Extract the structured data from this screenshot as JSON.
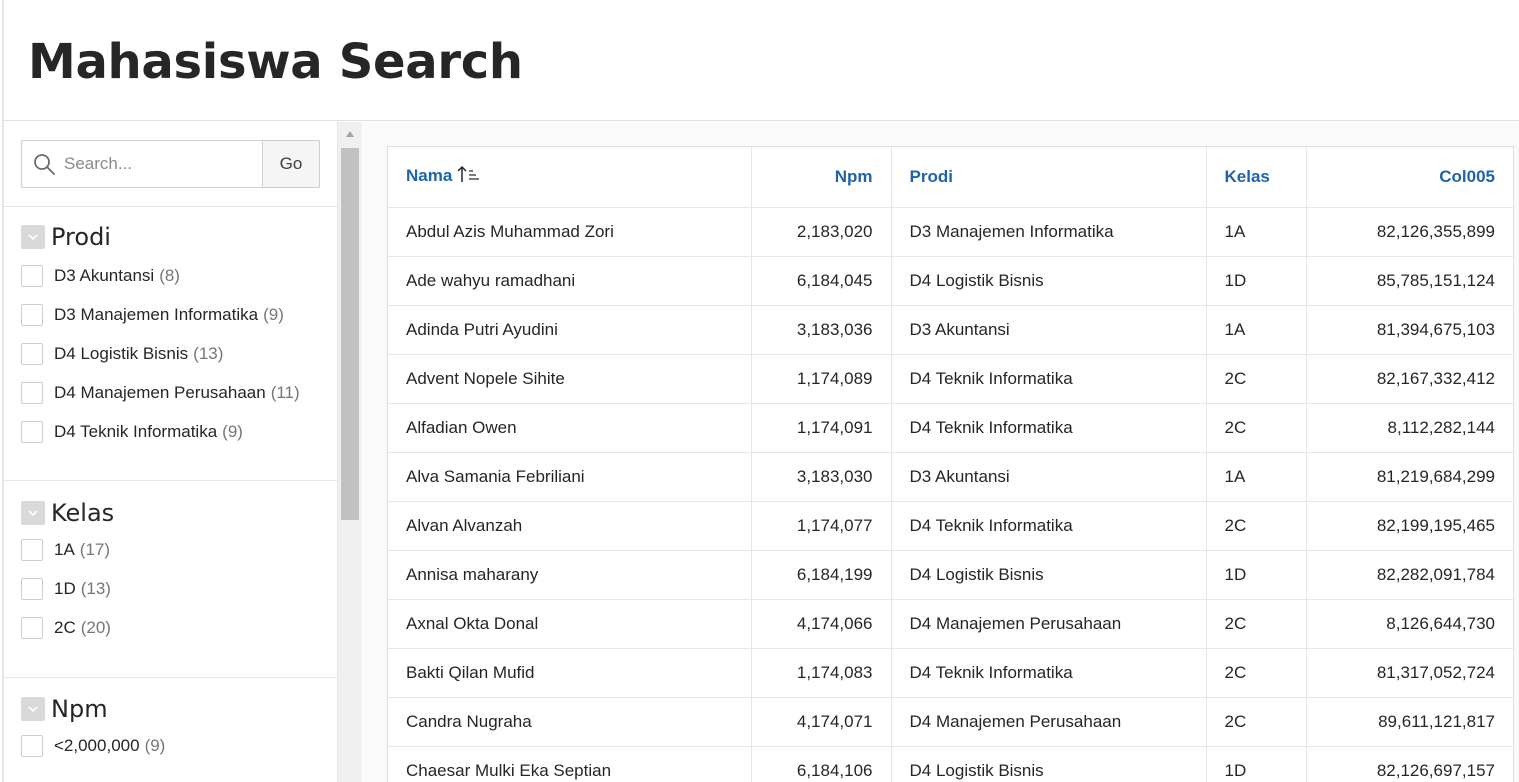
{
  "page": {
    "title": "Mahasiswa Search"
  },
  "search": {
    "placeholder": "Search...",
    "value": "",
    "go_label": "Go"
  },
  "facets": [
    {
      "title": "Prodi",
      "options": [
        {
          "label": "D3 Akuntansi",
          "count": "(8)"
        },
        {
          "label": "D3 Manajemen Informatika",
          "count": "(9)"
        },
        {
          "label": "D4 Logistik Bisnis",
          "count": "(13)"
        },
        {
          "label": "D4 Manajemen Perusahaan",
          "count": "(11)"
        },
        {
          "label": "D4 Teknik Informatika",
          "count": "(9)"
        }
      ]
    },
    {
      "title": "Kelas",
      "options": [
        {
          "label": "1A",
          "count": "(17)"
        },
        {
          "label": "1D",
          "count": "(13)"
        },
        {
          "label": "2C",
          "count": "(20)"
        }
      ]
    },
    {
      "title": "Npm",
      "options": [
        {
          "label": "<2,000,000",
          "count": "(9)"
        }
      ]
    }
  ],
  "table": {
    "columns": [
      "Nama",
      "Npm",
      "Prodi",
      "Kelas",
      "Col005"
    ],
    "sorted_column": "Nama",
    "rows": [
      [
        "Abdul Azis Muhammad Zori",
        "2,183,020",
        "D3 Manajemen Informatika",
        "1A",
        "82,126,355,899"
      ],
      [
        "Ade wahyu ramadhani",
        "6,184,045",
        "D4 Logistik Bisnis",
        "1D",
        "85,785,151,124"
      ],
      [
        "Adinda Putri Ayudini",
        "3,183,036",
        "D3 Akuntansi",
        "1A",
        "81,394,675,103"
      ],
      [
        "Advent Nopele Sihite",
        "1,174,089",
        "D4 Teknik Informatika",
        "2C",
        "82,167,332,412"
      ],
      [
        "Alfadian Owen",
        "1,174,091",
        "D4 Teknik Informatika",
        "2C",
        "8,112,282,144"
      ],
      [
        "Alva Samania Febriliani",
        "3,183,030",
        "D3 Akuntansi",
        "1A",
        "81,219,684,299"
      ],
      [
        "Alvan Alvanzah",
        "1,174,077",
        "D4 Teknik Informatika",
        "2C",
        "82,199,195,465"
      ],
      [
        "Annisa maharany",
        "6,184,199",
        "D4 Logistik Bisnis",
        "1D",
        "82,282,091,784"
      ],
      [
        "Axnal Okta Donal",
        "4,174,066",
        "D4 Manajemen Perusahaan",
        "2C",
        "8,126,644,730"
      ],
      [
        "Bakti Qilan Mufid",
        "1,174,083",
        "D4 Teknik Informatika",
        "2C",
        "81,317,052,724"
      ],
      [
        "Candra Nugraha",
        "4,174,071",
        "D4 Manajemen Perusahaan",
        "2C",
        "89,611,121,817"
      ],
      [
        "Chaesar Mulki Eka Septian",
        "6,184,106",
        "D4 Logistik Bisnis",
        "1D",
        "82,126,697,157"
      ]
    ]
  },
  "colors": {
    "link_blue": "#1f63ad",
    "border": "#e6e6e6"
  },
  "icons": {
    "search": "search-icon",
    "facet_toggle": "chevron-down-icon",
    "sort": "sort-ascending-icon"
  }
}
